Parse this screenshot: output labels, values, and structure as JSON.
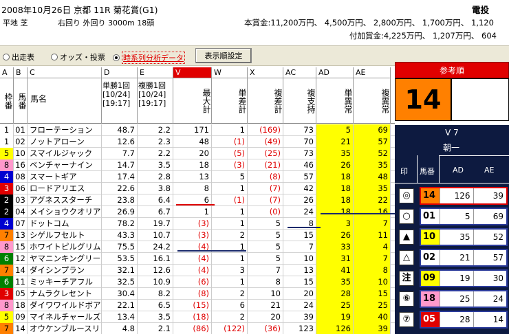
{
  "header": {
    "race": "2008年10月26日 京都 11R 菊花賞(G1)",
    "course": "平地 芝",
    "track": "右回り 外回り 3000m 18頭",
    "prize": "本賞金:11,200万円、 4,500万円、 2,800万円、 1,700万円、 1,120",
    "bonus": "付加賞金:4,225万円、 1,207万円、 604",
    "app_short": "電投"
  },
  "toolbar": {
    "radio_outside": "出走表",
    "radio_odds": "オッズ・投票",
    "radio_time": "時系列分析データ",
    "display_btn": "表示順設定"
  },
  "columns": {
    "letters": [
      "A",
      "B",
      "C",
      "D",
      "E",
      "V",
      "W",
      "X",
      "AC",
      "AD",
      "AE"
    ],
    "names": [
      "枠番",
      "馬番",
      "馬名",
      "単勝1回[10/24][19:17]",
      "複勝1回[10/24][19:17]",
      "最大計",
      "単差計",
      "複差計",
      "複支持",
      "単異常",
      "複異常"
    ]
  },
  "rows": [
    {
      "waku": "1",
      "ban": "01",
      "name": "フローテーション",
      "tan": "48.7",
      "fuku": "2.2",
      "v": "171",
      "w": "1",
      "x": "(169)",
      "ac": "73",
      "ad": "5",
      "ae": "69"
    },
    {
      "waku": "1",
      "ban": "02",
      "name": "ノットアローン",
      "tan": "12.6",
      "fuku": "2.3",
      "v": "48",
      "w": "(1)",
      "x": "(49)",
      "ac": "70",
      "ad": "21",
      "ae": "57"
    },
    {
      "waku": "5",
      "ban": "10",
      "name": "スマイルジャック",
      "tan": "7.7",
      "fuku": "2.2",
      "v": "20",
      "w": "(5)",
      "x": "(25)",
      "ac": "73",
      "ad": "35",
      "ae": "52"
    },
    {
      "waku": "8",
      "ban": "16",
      "name": "ベンチャーナイン",
      "tan": "14.7",
      "fuku": "3.5",
      "v": "18",
      "w": "(3)",
      "x": "(21)",
      "ac": "46",
      "ad": "26",
      "ae": "35"
    },
    {
      "waku": "4",
      "ban": "08",
      "name": "スマートギア",
      "tan": "17.4",
      "fuku": "2.8",
      "v": "13",
      "w": "5",
      "x": "(8)",
      "ac": "57",
      "ad": "18",
      "ae": "48"
    },
    {
      "waku": "3",
      "ban": "06",
      "name": "ロードアリエス",
      "tan": "22.6",
      "fuku": "3.8",
      "v": "8",
      "w": "1",
      "x": "(7)",
      "ac": "42",
      "ad": "18",
      "ae": "35"
    },
    {
      "waku": "2",
      "ban": "03",
      "name": "アグネススターチ",
      "tan": "23.8",
      "fuku": "6.4",
      "v": "6",
      "w": "(1)",
      "x": "(7)",
      "ac": "26",
      "ad": "18",
      "ae": "22"
    },
    {
      "waku": "2",
      "ban": "04",
      "name": "メイショウクオリア",
      "tan": "26.9",
      "fuku": "6.7",
      "v": "1",
      "w": "1",
      "x": "(0)",
      "ac": "24",
      "ad": "18",
      "ae": "16"
    },
    {
      "waku": "4",
      "ban": "07",
      "name": "ドットコム",
      "tan": "78.2",
      "fuku": "19.7",
      "v": "(3)",
      "w": "1",
      "x": "5",
      "ac": "8",
      "ad": "3",
      "ae": "7"
    },
    {
      "waku": "7",
      "ban": "13",
      "name": "シゲルフセルト",
      "tan": "43.3",
      "fuku": "10.7",
      "v": "(3)",
      "w": "2",
      "x": "5",
      "ac": "15",
      "ad": "26",
      "ae": "11"
    },
    {
      "waku": "8",
      "ban": "15",
      "name": "ホワイトピルグリム",
      "tan": "75.5",
      "fuku": "24.2",
      "v": "(4)",
      "w": "1",
      "x": "5",
      "ac": "7",
      "ad": "33",
      "ae": "4"
    },
    {
      "waku": "6",
      "ban": "12",
      "name": "ヤマニンキングリー",
      "tan": "53.5",
      "fuku": "16.1",
      "v": "(4)",
      "w": "1",
      "x": "5",
      "ac": "10",
      "ad": "31",
      "ae": "7"
    },
    {
      "waku": "7",
      "ban": "14",
      "name": "ダイシンプラン",
      "tan": "32.1",
      "fuku": "12.6",
      "v": "(4)",
      "w": "3",
      "x": "7",
      "ac": "13",
      "ad": "41",
      "ae": "8"
    },
    {
      "waku": "6",
      "ban": "11",
      "name": "ミッキーチアフル",
      "tan": "32.5",
      "fuku": "10.9",
      "v": "(6)",
      "w": "1",
      "x": "8",
      "ac": "15",
      "ad": "35",
      "ae": "10"
    },
    {
      "waku": "3",
      "ban": "05",
      "name": "ナムラクレセント",
      "tan": "30.4",
      "fuku": "8.2",
      "v": "(8)",
      "w": "2",
      "x": "10",
      "ac": "20",
      "ad": "28",
      "ae": "15"
    },
    {
      "waku": "8",
      "ban": "18",
      "name": "ダイワワイルドボア",
      "tan": "22.1",
      "fuku": "6.5",
      "v": "(15)",
      "w": "6",
      "x": "21",
      "ac": "24",
      "ad": "25",
      "ae": "25"
    },
    {
      "waku": "5",
      "ban": "09",
      "name": "マイネルチャールズ",
      "tan": "13.4",
      "fuku": "3.5",
      "v": "(18)",
      "w": "2",
      "x": "20",
      "ac": "39",
      "ad": "19",
      "ae": "40"
    },
    {
      "waku": "7",
      "ban": "14",
      "name": "オウケンブルースリ",
      "tan": "4.8",
      "fuku": "2.1",
      "v": "(86)",
      "w": "(122)",
      "x": "(36)",
      "ac": "123",
      "ad": "126",
      "ae": "39"
    }
  ],
  "panel": {
    "title": "参考順",
    "top_number": "14",
    "group_label": "V 7",
    "source": "朝一",
    "col_mark": "印",
    "col_ban": "馬番",
    "col_ad": "AD",
    "col_ae": "AE",
    "picks": [
      {
        "mark": "◎",
        "ban": "14",
        "ad": "126",
        "ae": "39"
      },
      {
        "mark": "○",
        "ban": "01",
        "ad": "5",
        "ae": "69"
      },
      {
        "mark": "▲",
        "ban": "10",
        "ad": "35",
        "ae": "52"
      },
      {
        "mark": "△",
        "ban": "02",
        "ad": "21",
        "ae": "57"
      },
      {
        "mark": "注",
        "ban": "09",
        "ad": "19",
        "ae": "30"
      },
      {
        "mark": "⑥",
        "ban": "18",
        "ad": "25",
        "ae": "24"
      },
      {
        "mark": "⑦",
        "ban": "05",
        "ad": "28",
        "ae": "14"
      }
    ]
  },
  "colors": {
    "waku": {
      "1": "#ffffff",
      "2": "#000000",
      "3": "#e00000",
      "4": "#0000d0",
      "5": "#ffff00",
      "6": "#008000",
      "7": "#ff8000",
      "8": "#ff99cc"
    },
    "waku_text": {
      "1": "#000000",
      "2": "#ffffff",
      "3": "#ffffff",
      "4": "#ffffff",
      "5": "#000000",
      "6": "#ffffff",
      "7": "#000000",
      "8": "#000000"
    },
    "highlight": "#ffff00",
    "accent_red": "#e00000",
    "panel_dark": "#0d1a40"
  }
}
